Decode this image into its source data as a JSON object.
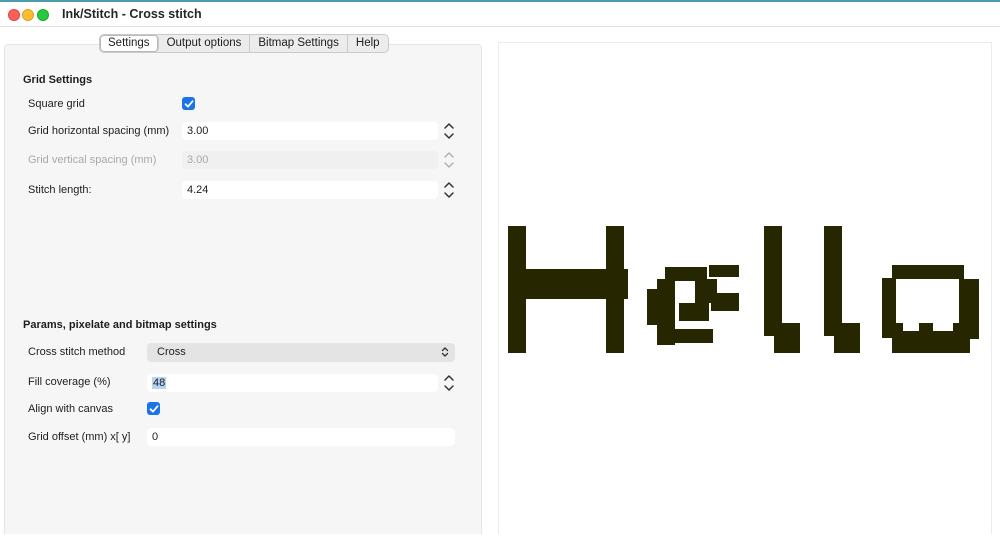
{
  "window": {
    "title": "Ink/Stitch - Cross stitch"
  },
  "tabs": [
    {
      "label": "Settings",
      "active": true
    },
    {
      "label": "Output options",
      "active": false
    },
    {
      "label": "Bitmap Settings",
      "active": false
    },
    {
      "label": "Help",
      "active": false
    }
  ],
  "grid": {
    "heading": "Grid Settings",
    "square_grid_label": "Square grid",
    "square_grid_checked": true,
    "h_spacing_label": "Grid horizontal spacing (mm)",
    "h_spacing_value": "3.00",
    "v_spacing_label": "Grid vertical spacing (mm)",
    "v_spacing_value": "3.00",
    "stitch_length_label": "Stitch length:",
    "stitch_length_value": "4.24"
  },
  "params": {
    "heading": "Params, pixelate and bitmap settings",
    "method_label": "Cross stitch method",
    "method_value": "Cross",
    "fill_label": "Fill coverage (%)",
    "fill_value": "48",
    "align_label": "Align with canvas",
    "align_checked": true,
    "offset_label": "Grid offset (mm) x[ y]",
    "offset_value": "0"
  },
  "preview": {
    "text": "Hello",
    "color": "#262600"
  },
  "colors": {
    "accent": "#1a73e8",
    "stitch": "#262600"
  },
  "icons": {
    "close": "close-traffic-light",
    "minimize": "minimize-traffic-light",
    "maximize": "maximize-traffic-light",
    "spinner": "chevron-up-down-icon",
    "checkbox": "checkmark-icon"
  }
}
